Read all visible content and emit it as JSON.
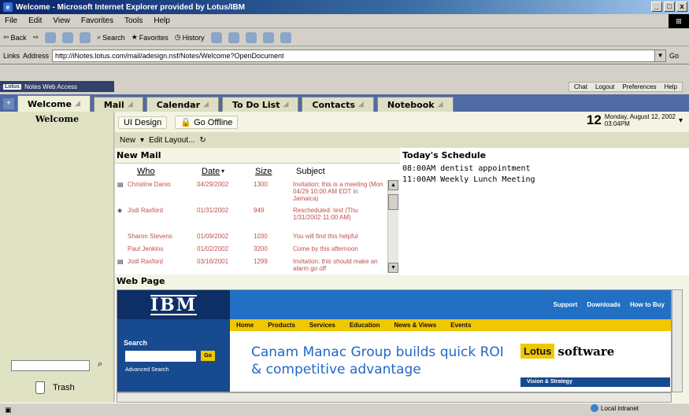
{
  "window": {
    "title": "Welcome - Microsoft Internet Explorer provided by Lotus/IBM",
    "controls": [
      "_",
      "□",
      "x"
    ]
  },
  "menubar": [
    "File",
    "Edit",
    "View",
    "Favorites",
    "Tools",
    "Help"
  ],
  "toolbar": {
    "back": "Back",
    "search": "Search",
    "favorites": "Favorites",
    "history": "History"
  },
  "address": {
    "links_label": "Links",
    "label": "Address",
    "url": "http://iNotes.lotus.com/mail/adesign.nsf/Notes/Welcome?OpenDocument",
    "go_label": "Go"
  },
  "notes": {
    "brand": "Notes Web Access",
    "brand_mark": "Lotus",
    "util_links": [
      "Chat",
      "Logout",
      "Preferences",
      "Help"
    ]
  },
  "tabs": [
    "Welcome",
    "Mail",
    "Calendar",
    "To Do List",
    "Contacts",
    "Notebook"
  ],
  "left": {
    "title": "Welcome",
    "trash_label": "Trash"
  },
  "actions_top": {
    "ui_design": "UI Design",
    "go_offline": "Go Offline"
  },
  "date": {
    "day": "12",
    "line1": "Monday, August 12, 2002",
    "line2": "03:04PM"
  },
  "actions_bar": {
    "new": "New",
    "edit_layout": "Edit Layout..."
  },
  "newmail": {
    "title": "New Mail",
    "columns": [
      "Who",
      "Date",
      "Size",
      "Subject"
    ],
    "rows": [
      {
        "who": "Christine Danio",
        "date": "04/29/2002",
        "size": "1300",
        "subject": "Invitation: this is a meeting (Mon 04/29 10:00 AM EDT in Jamaica)"
      },
      {
        "who": "Jodi Raxford",
        "date": "01/31/2002",
        "size": "949",
        "subject": "Rescheduled: test (Thu 1/31/2002 11:00 AM)"
      },
      {
        "who": "Sharon Stevens",
        "date": "01/09/2002",
        "size": "1030",
        "subject": "You will find this helpful"
      },
      {
        "who": "Paul Jenkins",
        "date": "01/02/2002",
        "size": "3200",
        "subject": "Come by this afternoon"
      },
      {
        "who": "Jodi Raxford",
        "date": "03/16/2001",
        "size": "1299",
        "subject": "Invitation: this should make an alarm go off"
      }
    ]
  },
  "schedule": {
    "title": "Today's Schedule",
    "items": [
      "08:00AM dentist appointment",
      "11:00AM Weekly Lunch Meeting"
    ]
  },
  "webpage": {
    "title": "Web Page",
    "ibm_logo": "IBM",
    "top_links": [
      "Support",
      "Downloads",
      "How to Buy"
    ],
    "nav": [
      "Home",
      "Products",
      "Services",
      "Education",
      "News & Views",
      "Events"
    ],
    "search_label": "Search",
    "go": "Go",
    "advanced_search": "Advanced Search",
    "headline": "Canam Manac Group builds quick ROI & competitive advantage",
    "lotus_box": "Lotus",
    "lotus_software": "software",
    "vision": "Vision & Strategy"
  },
  "status": {
    "zone": "Local intranet"
  }
}
